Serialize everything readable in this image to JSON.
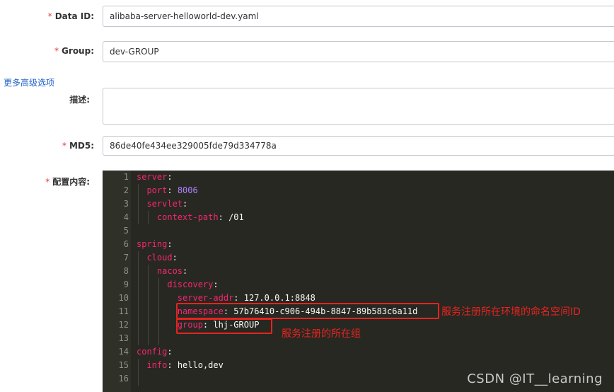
{
  "form": {
    "data_id": {
      "label": "Data ID:",
      "value": "alibaba-server-helloworld-dev.yaml"
    },
    "group": {
      "label": "Group:",
      "value": "dev-GROUP"
    },
    "more_options_link": "更多高级选项",
    "description": {
      "label": "描述:",
      "value": ""
    },
    "md5": {
      "label": "MD5:",
      "value": "86de40fe434ee329005fde79d334778a"
    },
    "content": {
      "label": "配置内容:"
    },
    "required_mark": "*"
  },
  "editor": {
    "lines": [
      {
        "num": "1",
        "text": "server:"
      },
      {
        "num": "2",
        "text": "  port: 8006"
      },
      {
        "num": "3",
        "text": "  servlet:"
      },
      {
        "num": "4",
        "text": "    context-path: /01"
      },
      {
        "num": "5",
        "text": ""
      },
      {
        "num": "6",
        "text": "spring:"
      },
      {
        "num": "7",
        "text": "  cloud:"
      },
      {
        "num": "8",
        "text": "    nacos:"
      },
      {
        "num": "9",
        "text": "      discovery:"
      },
      {
        "num": "10",
        "text": "        server-addr: 127.0.0.1:8848"
      },
      {
        "num": "11",
        "text": "        namespace: 57b76410-c906-494b-8847-89b583c6a11d"
      },
      {
        "num": "12",
        "text": "        group: lhj-GROUP"
      },
      {
        "num": "13",
        "text": ""
      },
      {
        "num": "14",
        "text": "config:"
      },
      {
        "num": "15",
        "text": "  info: hello,dev"
      },
      {
        "num": "16",
        "text": ""
      }
    ]
  },
  "annotations": {
    "namespace_note": "服务注册所在环境的命名空间ID",
    "group_note": "服务注册的所在组"
  },
  "watermark": "CSDN @IT__learning",
  "colors": {
    "annotation": "#e8231f",
    "editor_bg": "#272822",
    "link": "#1f63c9"
  }
}
